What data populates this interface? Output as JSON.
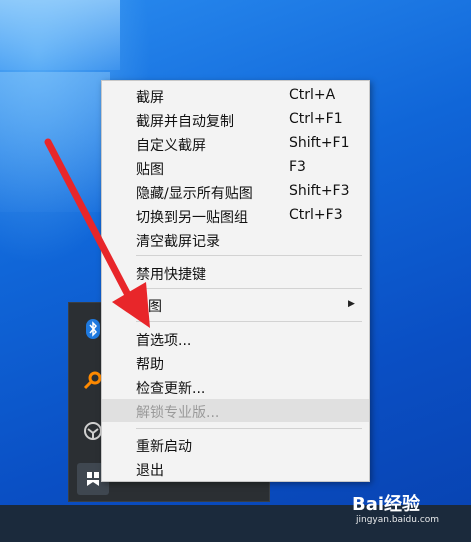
{
  "menu": {
    "items": [
      {
        "label": "截屏",
        "shortcut": "Ctrl+A"
      },
      {
        "label": "截屏并自动复制",
        "shortcut": "Ctrl+F1"
      },
      {
        "label": "自定义截屏",
        "shortcut": "Shift+F1"
      },
      {
        "label": "贴图",
        "shortcut": "F3"
      },
      {
        "label": "隐藏/显示所有贴图",
        "shortcut": "Shift+F3"
      },
      {
        "label": "切换到另一贴图组",
        "shortcut": "Ctrl+F3"
      },
      {
        "label": "清空截屏记录",
        "shortcut": ""
      },
      {
        "label": "禁用快捷键",
        "shortcut": ""
      },
      {
        "label": "图",
        "shortcut": ""
      },
      {
        "label": "首选项...",
        "shortcut": ""
      },
      {
        "label": "帮助",
        "shortcut": ""
      },
      {
        "label": "检查更新...",
        "shortcut": ""
      },
      {
        "label": "解锁专业版...",
        "shortcut": ""
      },
      {
        "label": "重新启动",
        "shortcut": ""
      },
      {
        "label": "退出",
        "shortcut": ""
      }
    ]
  },
  "tray": {
    "icons": [
      "bluetooth-icon",
      "search-key-icon",
      "shield-icon",
      "snipaste-icon"
    ]
  },
  "watermark": {
    "logo": "Bai经验",
    "url": "jingyan.baidu.com"
  },
  "colors": {
    "annotation_arrow": "#e8262a",
    "menu_bg": "#f3f3f3",
    "disabled_row": "#e0e0e0"
  }
}
